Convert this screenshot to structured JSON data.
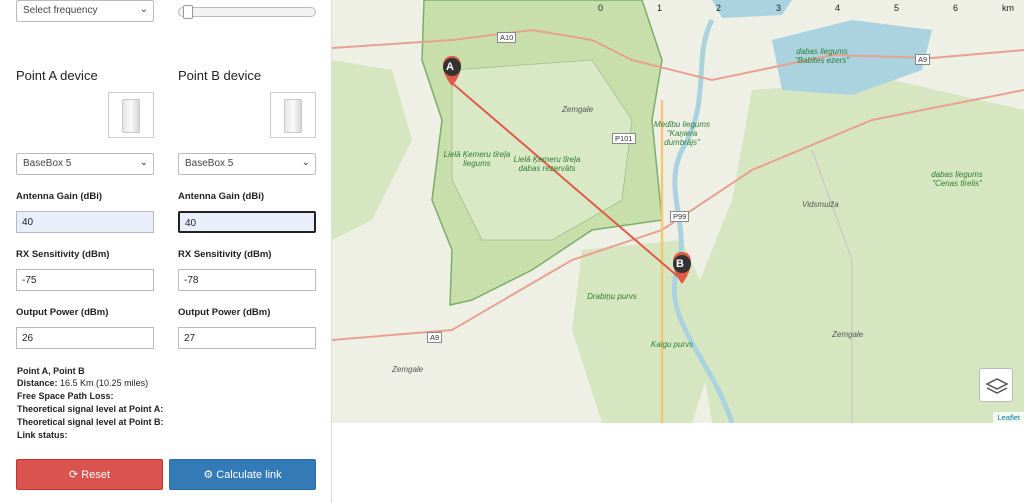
{
  "frequency_select": {
    "label": "Select frequency"
  },
  "point_a": {
    "title": "Point A device",
    "device": "BaseBox 5",
    "antenna_gain_label": "Antenna Gain (dBi)",
    "antenna_gain": "40",
    "rx_sensitivity_label": "RX Sensitivity (dBm)",
    "rx_sensitivity": "-75",
    "output_power_label": "Output Power (dBm)",
    "output_power": "26"
  },
  "point_b": {
    "title": "Point B device",
    "device": "BaseBox 5",
    "antenna_gain_label": "Antenna Gain (dBi)",
    "antenna_gain": "40",
    "rx_sensitivity_label": "RX Sensitivity (dBm)",
    "rx_sensitivity": "-78",
    "output_power_label": "Output Power (dBm)",
    "output_power": "27"
  },
  "results": {
    "points": "Point A, Point B",
    "distance_label": "Distance:",
    "distance_value": "16.5 Km (10.25 miles)",
    "fspl_label": "Free Space Path Loss:",
    "signal_a_label": "Theoretical signal level at Point A:",
    "signal_b_label": "Theoretical signal level at Point B:",
    "link_status_label": "Link status:"
  },
  "buttons": {
    "reset": "Reset",
    "calculate": "Calculate link"
  },
  "map": {
    "scale_numbers": [
      "0",
      "1",
      "2",
      "3",
      "4",
      "5",
      "6"
    ],
    "scale_unit": "km",
    "marker_a": "A",
    "marker_b": "B",
    "labels": {
      "babites": "dabas liegums \"Babītes ezers\"",
      "kemeru_liegums": "Lielā Ķemeru tīreļa liegums",
      "kemeru_rezervats": "Lielā Ķemeru tīreļa dabas rezervāts",
      "medibu": "Medību liegums \"Kaņiera dumbrājs\"",
      "cenas": "dabas liegums \"Cenas tīrelis\"",
      "drabinu": "Drabiņu purvs",
      "kaigu": "Kaigu purvs",
      "zemgale_top": "Zemgale",
      "zemgale_bottom": "Zemgale",
      "zemgale_right": "Zemgale",
      "vidsmuiza": "Vidsmuiža"
    },
    "roads": {
      "a10": "A10",
      "a9_left": "A9",
      "a9_right": "A9",
      "p101": "P101",
      "p99": "P99"
    },
    "attribution": "Leaflet"
  },
  "colors": {
    "reset": "#d9534f",
    "calculate": "#337ab7",
    "link_line": "#e05a47",
    "forest": "#cfe3b4",
    "water": "#aad3df"
  }
}
